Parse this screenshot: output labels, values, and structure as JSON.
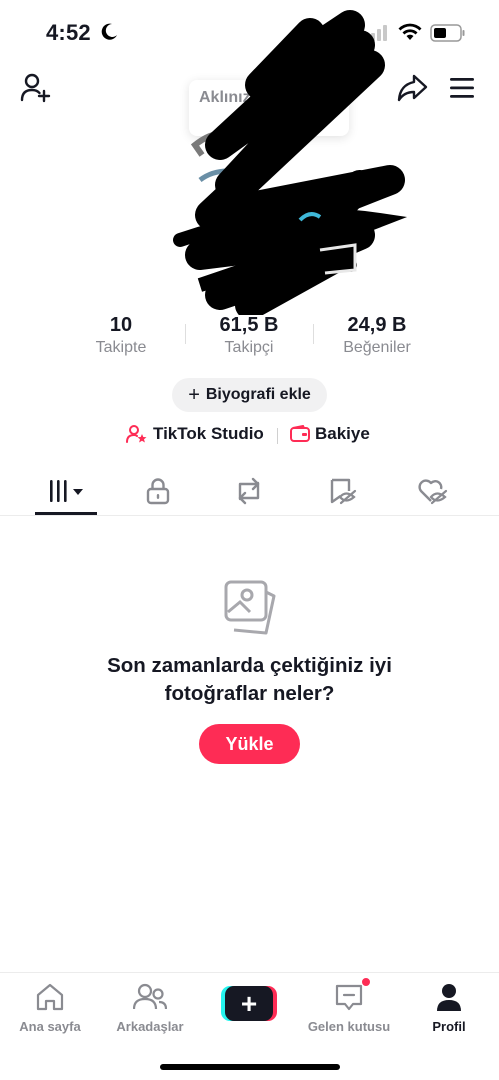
{
  "status_bar": {
    "time": "4:52"
  },
  "header": {
    "bubble_text": "Aklınız"
  },
  "stats": [
    {
      "value": "10",
      "label": "Takipte"
    },
    {
      "value": "61,5 B",
      "label": "Takipçi"
    },
    {
      "value": "24,9 B",
      "label": "Beğeniler"
    }
  ],
  "bio_button": {
    "plus": "+",
    "label": "Biyografi ekle"
  },
  "links": {
    "studio": "TikTok Studio",
    "balance": "Bakiye"
  },
  "tabs": [
    "videos-grid-icon",
    "private-lock-icon",
    "reposts-icon",
    "favorites-icon",
    "liked-icon"
  ],
  "empty_state": {
    "title_line1": "Son zamanlarda çektiğiniz iyi",
    "title_line2": "fotoğraflar neler?",
    "button": "Yükle"
  },
  "bottom_nav": {
    "home": "Ana sayfa",
    "friends": "Arkadaşlar",
    "create": "+",
    "inbox": "Gelen kutusu",
    "profile": "Profil"
  },
  "colors": {
    "accent": "#fe2c55",
    "cyan": "#25f4ee",
    "text": "#161823",
    "muted": "#8a8b91"
  }
}
